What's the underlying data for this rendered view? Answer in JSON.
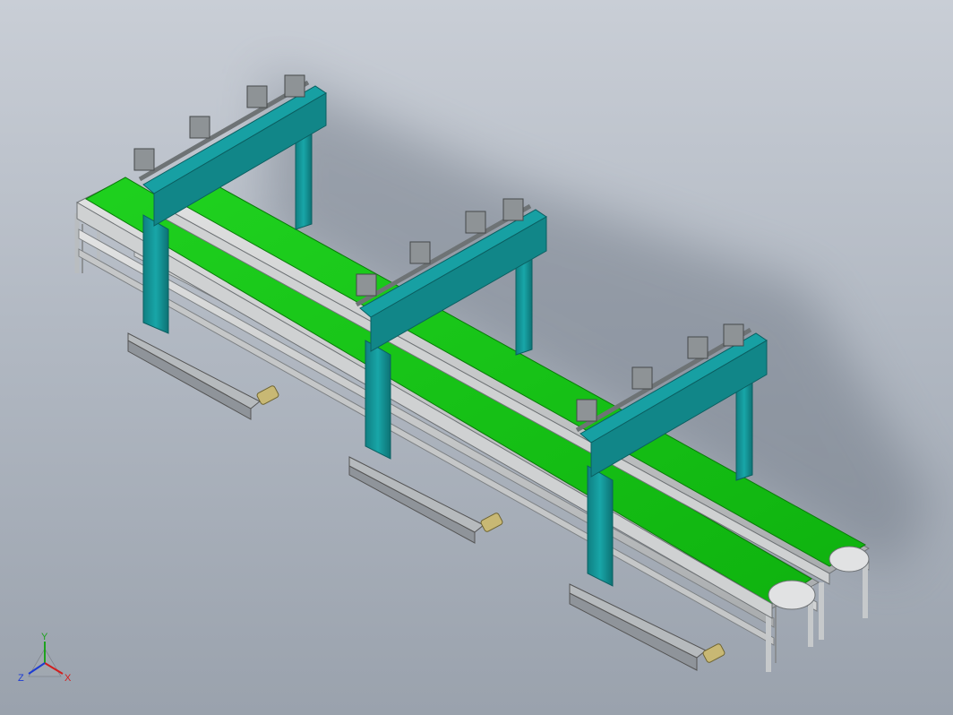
{
  "view": {
    "background_top": "#c9ced6",
    "background_bottom": "#9aa2ad"
  },
  "model": {
    "belt_color": "#14c614",
    "frame_color": "#159a9b",
    "rail_color": "#c9cbcc",
    "base_color": "#8f949a",
    "gantry_count": 3,
    "lane_count": 2
  },
  "triad": {
    "x_label": "X",
    "y_label": "Y",
    "z_label": "Z",
    "x_color": "#d21e1e",
    "y_color": "#1ea21e",
    "z_color": "#1e3cd2"
  }
}
